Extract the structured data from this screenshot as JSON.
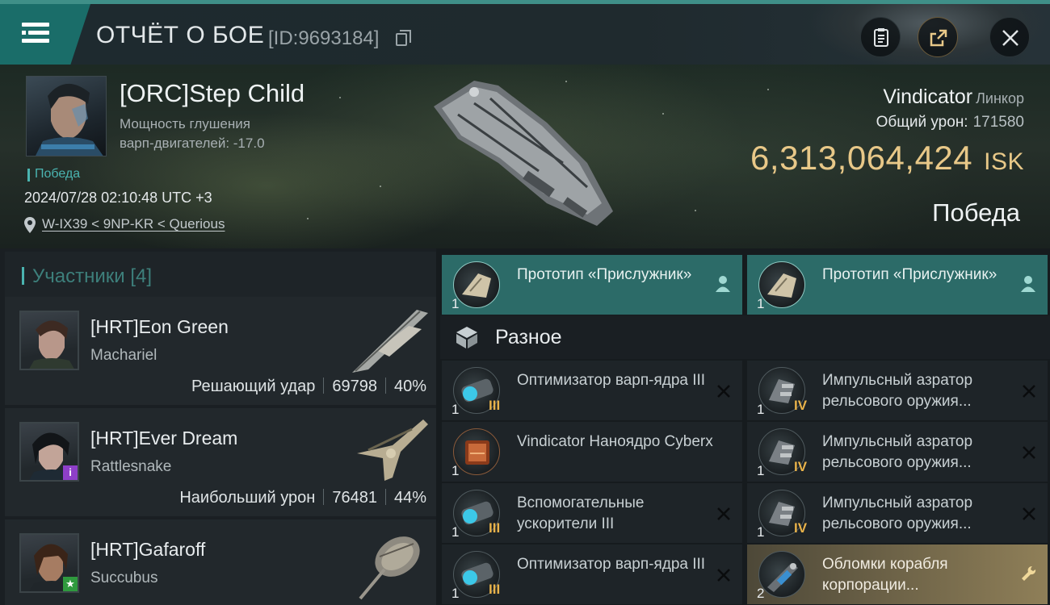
{
  "header": {
    "title": "ОТЧЁТ О БОЕ",
    "report_id": "[ID:9693184]"
  },
  "victim": {
    "name": "[ORC]Step Child",
    "jam_line1": "Мощность глушения",
    "jam_line2": "варп-двигателей: -17.0",
    "tag": "Победа",
    "datetime": "2024/07/28 02:10:48 UTC +3",
    "location": "W-IX39 < 9NP-KR < Querious",
    "ship_name": "Vindicator",
    "ship_class": "Линкор",
    "total_damage_label": "Общий урон:",
    "total_damage_value": "171580",
    "isk_value": "6,313,064,424",
    "isk_unit": "ISK",
    "result": "Победа"
  },
  "participants": {
    "title": "Участники [4]",
    "rows": [
      {
        "name": "[HRT]Eon Green",
        "ship": "Machariel",
        "stat_label": "Решающий удар",
        "damage": "69798",
        "percent": "40%"
      },
      {
        "name": "[HRT]Ever Dream",
        "ship": "Rattlesnake",
        "stat_label": "Наибольший урон",
        "damage": "76481",
        "percent": "44%"
      },
      {
        "name": "[HRT]Gafaroff",
        "ship": "Succubus",
        "stat_label": "",
        "damage": "",
        "percent": ""
      }
    ]
  },
  "modules": {
    "drones": [
      {
        "name": "Прототип «Прислужник»",
        "qty": "1"
      },
      {
        "name": "Прототип «Прислужник»",
        "qty": "1"
      }
    ],
    "section_title": "Разное",
    "left": [
      {
        "name": "Оптимизатор варп-ядра III",
        "qty": "1",
        "level": "III"
      },
      {
        "name": "Vindicator Наноядро Cyberx",
        "qty": "1",
        "level": ""
      },
      {
        "name": "Вспомогательные ускорители III",
        "qty": "1",
        "level": "III"
      },
      {
        "name": "Оптимизатор варп-ядра III",
        "qty": "1",
        "level": "III"
      }
    ],
    "right": [
      {
        "name": "Импульсный азратор рельсового оружия...",
        "qty": "1",
        "level": "IV"
      },
      {
        "name": "Импульсный азратор рельсового оружия...",
        "qty": "1",
        "level": "IV"
      },
      {
        "name": "Импульсный азратор рельсового оружия...",
        "qty": "1",
        "level": "IV"
      },
      {
        "name": "Обломки корабля корпорации...",
        "qty": "2",
        "level": ""
      }
    ]
  },
  "colors": {
    "accent_teal": "#4ab4b0",
    "drone_slot": "#2c6b68",
    "isk_gold": "#e8c888",
    "dropped_slot": "#8f7f58"
  }
}
